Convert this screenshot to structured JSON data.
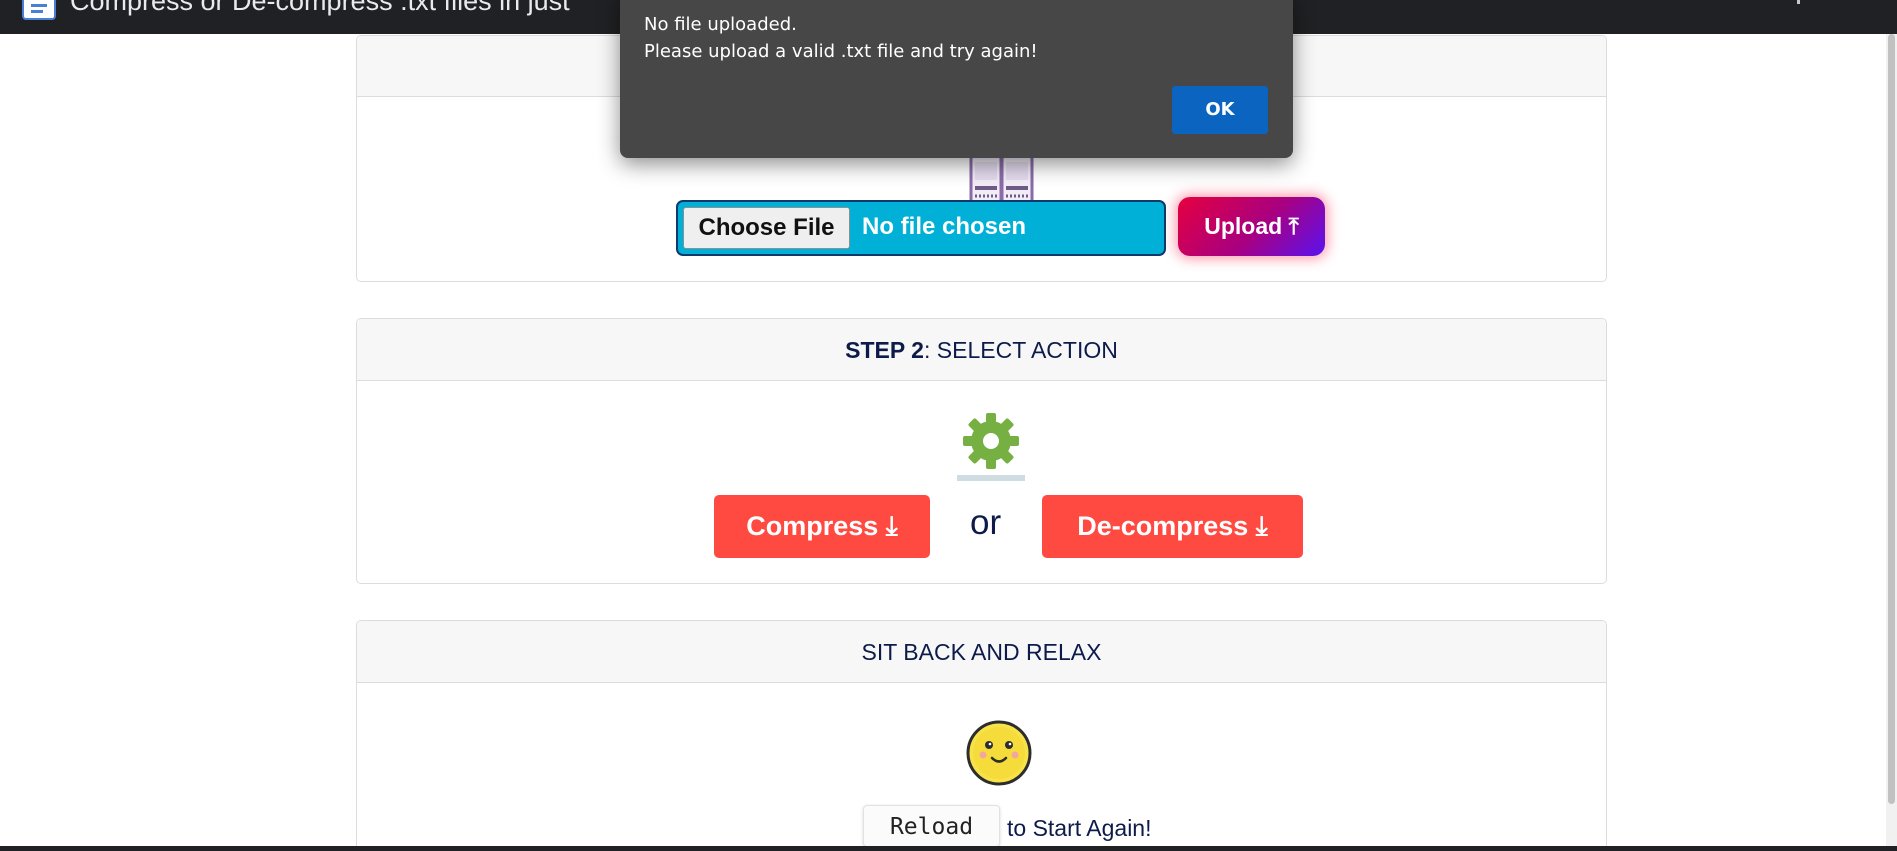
{
  "browser": {
    "tab_title": "Compress or De-compress .txt files in just"
  },
  "dialog": {
    "line1": "No file uploaded.",
    "line2": "Please upload a valid .txt file and try again!",
    "ok_label": "OK"
  },
  "step1": {
    "choose_file_label": "Choose File",
    "file_status": "No file chosen",
    "upload_label": "Upload ⤒",
    "icon": "files-icon"
  },
  "step2": {
    "header_bold": "STEP 2",
    "header_rest": ": SELECT ACTION",
    "icon": "gear-icon",
    "compress_label": "Compress ⤓",
    "or_label": "or",
    "decompress_label": "De-compress ⤓"
  },
  "step3": {
    "header": "SIT BACK AND RELAX",
    "icon": "smiley-icon",
    "reload_label": "Reload",
    "start_again_text": "to Start Again!"
  },
  "colors": {
    "accent_red": "#ff4a42",
    "file_input_bg": "#00b0d6",
    "dialog_bg": "#474747",
    "ok_button": "#0b64c0",
    "heading_text": "#0d1b4a"
  }
}
